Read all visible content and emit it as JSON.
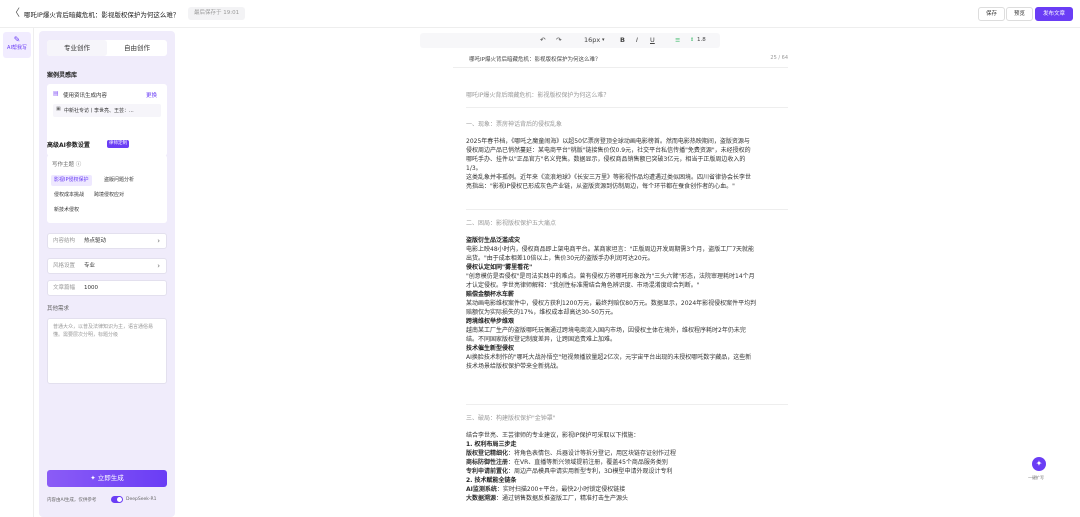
{
  "topbar": {
    "back_glyph": "〈",
    "title": "哪吒IP爆火背后暗藏危机：影视版权保护为何这么难？",
    "saved": "最后保存于 19:01",
    "save_label": "保存",
    "preview_label": "预览",
    "publish_label": "发布文章"
  },
  "rail": {
    "icon": "edit-icon",
    "label": "AI帮我写"
  },
  "panel": {
    "tabs": [
      "专业创作",
      "自由创作"
    ],
    "case_section": "案例灵感库",
    "info_label": "使用资讯生成内容",
    "info_action": "更换",
    "info_item": "中新社专访丨李世亮、王芸：...",
    "param_section": "高级AI参数设置",
    "param_badge": "律师定制",
    "topic_label": "写作主题 ⓘ",
    "chips": [
      "影视IP侵权保护",
      "盗版问题分析",
      "侵权成本挑战",
      "跨境侵权应对",
      "新技术侵权"
    ],
    "structure_key": "内容结构",
    "structure_val": "热点驱动",
    "style_key": "风格设置",
    "style_val": "专业",
    "length_key": "文章篇幅",
    "length_val": "1000",
    "other_label": "其他需求",
    "other_text": "普通大众，以普及法律知识为主，语言通俗易懂。需要层次分明，标题分级",
    "gen_label": "立即生成",
    "footer_text": "内容由AI生成，仅供参考",
    "model": "DeepSeek-R1"
  },
  "toolbar": {
    "undo": "↶",
    "redo": "↷",
    "size": "16px",
    "bold": "B",
    "italic": "I",
    "underline": "U",
    "align": "≡",
    "spacing": "1.8"
  },
  "doc": {
    "header": "哪吒IP爆火背后暗藏危机：影视版权保护为何这么难？",
    "count": "25 / 64",
    "title": "哪吒IP爆火背后暗藏危机：影视版权保护为何这么难？",
    "s1": "一、现象：票房神话背后的侵权乱象",
    "p1a": "2025年春节档，《哪吒之魔童闹海》以超50亿票房登顶全球动画电影榜首。然而电影热映期间，盗版资源与",
    "p1b": "侵权周边产品已悄然蔓延：某电商平台\"桃版\"链接售价仅0.9元，社交平台私信传播\"免费资源\"，未经授权的",
    "p1c": "哪吒手办、挂件以\"正品官方\"名义兜售。数据显示，侵权商品销售额已突破3亿元，相当于正版周边收入的",
    "p1d": "1/3。",
    "p1e": "这类乱象并非孤例。近年来《流浪地球》《长安三万里》等影视作品均遭遇过类似困境。四川省律协会长李世",
    "p1f": "亮指出：\"影视IP侵权已形成灰色产业链，从盗版资源到仿制周边，每个环节都在蚕食创作者的心血。\"",
    "s2": "二、困局：影视版权保护五大痛点",
    "b1": "盗版衍生品泛滥成灾",
    "p2a": "电影上映48小时内，侵权商品即上架电商平台。某商家坦言：\"正版周边开发周期需3个月，盗版工厂7天就能",
    "p2b": "出货。\"由于成本相差10倍以上，售价30元的盗版手办利润可达20元。",
    "b2": "侵权认定如同\"雾里看花\"",
    "p2c": "\"创意模仿是否侵权\"是司法实践中的难点。曾有侵权方将哪吒形象改为\"三头六臂\"形态，法院审理耗时14个月",
    "p2d": "才认定侵权。李世亮律师解释：\"我创性标准需结合角色辨识度、市场混淆度综合判断。\"",
    "b3": "赔偿金额杯水车薪",
    "p2e": "某动画电影维权案件中，侵权方获利1200万元，最终判赔仅80万元。数据显示，2024年影视侵权案件平均判",
    "p2f": "赔额仅为实际损失的17%，维权成本却高达30-50万元。",
    "b4": "跨境维权举步维艰",
    "p2g": "越南某工厂生产的盗版哪吒玩偶通过跨境电商流入国内市场，因侵权主体在境外，维权程序耗时2年仍未完",
    "p2h": "结。不同国家版权登记制度差异，让跨国追责难上加难。",
    "b5": "技术催生新型侵权",
    "p2i": "AI换脸技术制作的\"哪吒大战孙悟空\"短视频播放量超2亿次，元宇宙平台出现的未授权哪吒数字藏品，这些新",
    "p2j": "技术场景给版权保护带来全新挑战。",
    "s3": "三、破局：构建版权保护\"金钟罩\"",
    "p3a": "结合李世亮、王芸律师的专业建议，影视IP保护可采取以下措施：",
    "b6": "1. 权利布局三步走",
    "p3b_k": "版权登记精细化",
    "p3b": "：将角色表情包、兵器设计等拆分登记，用区块链存证创作过程",
    "p3c_k": "商标防御性注册",
    "p3c": "：在VR、直播等新兴领域提前注册，覆盖45个商品服务类别",
    "p3d_k": "专利申请前置化",
    "p3d": "：周边产品模具申请实用新型专利，3D模型申请外观设计专利",
    "b7": "2. 技术赋能全链条",
    "p3e_k": "AI监测系统",
    "p3e": "：实时扫描200+平台，最快2小时锁定侵权链接",
    "p3f_k": "大数据溯源",
    "p3f": "：通过销售数据反推盗版工厂，精准打击生产源头"
  },
  "float": {
    "icon": "sparkle-icon",
    "label": "一键扩写"
  }
}
